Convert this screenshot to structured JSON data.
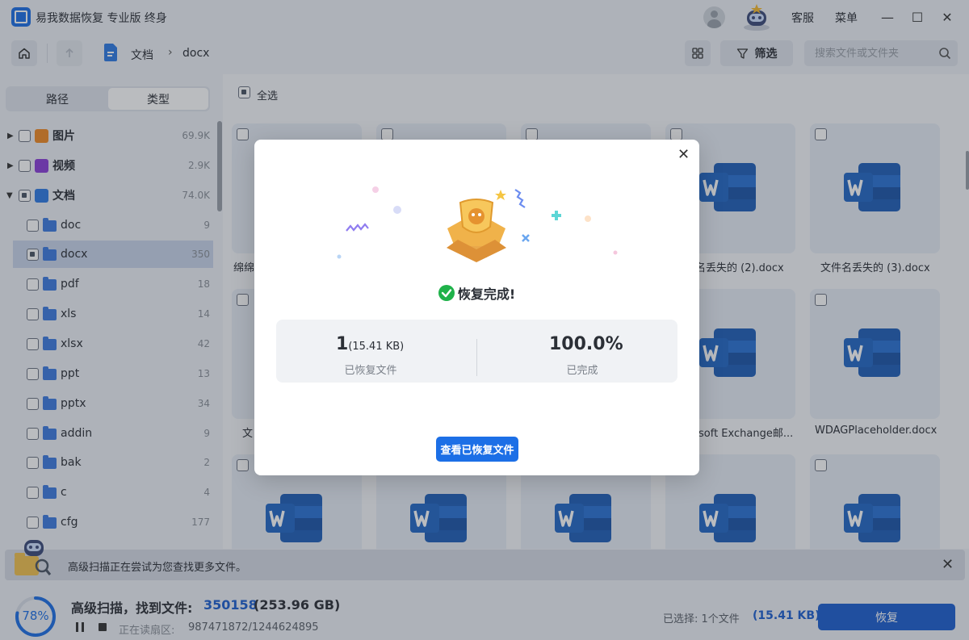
{
  "app": {
    "title": "易我数据恢复 专业版 终身"
  },
  "titlebar": {
    "service": "客服",
    "menu": "菜单",
    "minimize": "—",
    "maximize": "☐",
    "close": "✕"
  },
  "toolbar": {
    "breadcrumb": [
      "文档",
      "docx"
    ],
    "breadcrumb_sep": "›",
    "filter_label": "筛选",
    "search_placeholder": "搜索文件或文件夹"
  },
  "sidebar": {
    "tabs": [
      "路径",
      "类型"
    ],
    "active_tab": 1,
    "categories": [
      {
        "label": "图片",
        "count": "69.9K",
        "color": "#f08a24"
      },
      {
        "label": "视频",
        "count": "2.9K",
        "color": "#8b3fd9"
      },
      {
        "label": "文档",
        "count": "74.0K",
        "color": "#2f7be5"
      }
    ],
    "folders": [
      {
        "label": "doc",
        "count": "9"
      },
      {
        "label": "docx",
        "count": "350"
      },
      {
        "label": "pdf",
        "count": "18"
      },
      {
        "label": "xls",
        "count": "14"
      },
      {
        "label": "xlsx",
        "count": "42"
      },
      {
        "label": "ppt",
        "count": "13"
      },
      {
        "label": "pptx",
        "count": "34"
      },
      {
        "label": "addin",
        "count": "9"
      },
      {
        "label": "bak",
        "count": "2"
      },
      {
        "label": "c",
        "count": "4"
      },
      {
        "label": "cfg",
        "count": "177"
      }
    ]
  },
  "main": {
    "select_all": "全选",
    "card_names": [
      "绵绵",
      "名丢失的 (2).docx",
      "文件名丢失的 (3).docx",
      "文",
      "soft Exchange邮...",
      "WDAGPlaceholder.docx"
    ]
  },
  "notice": {
    "text": "高级扫描正在尝试为您查找更多文件。",
    "close": "✕"
  },
  "bottom": {
    "progress": "78%",
    "progress_value": 0.78,
    "scan_title": "高级扫描，找到文件:",
    "found_count": "350158",
    "found_size": "(253.96 GB)",
    "reading_label": "正在读扇区:",
    "reading_value": "987471872/1244624895",
    "selected_label": "已选择: 1个文件",
    "selected_size": "(15.41 KB)",
    "recover_button": "恢复"
  },
  "modal": {
    "close": "✕",
    "done_text": "恢复完成!",
    "recovered_count": "1",
    "recovered_size": "(15.41 KB)",
    "recovered_label": "已恢复文件",
    "percent": "100.0%",
    "percent_label": "已完成",
    "view_button": "查看已恢复文件"
  },
  "colors": {
    "accent": "#1c6fe6",
    "button_dark": "#1c5fd0",
    "success": "#1fb24a"
  }
}
